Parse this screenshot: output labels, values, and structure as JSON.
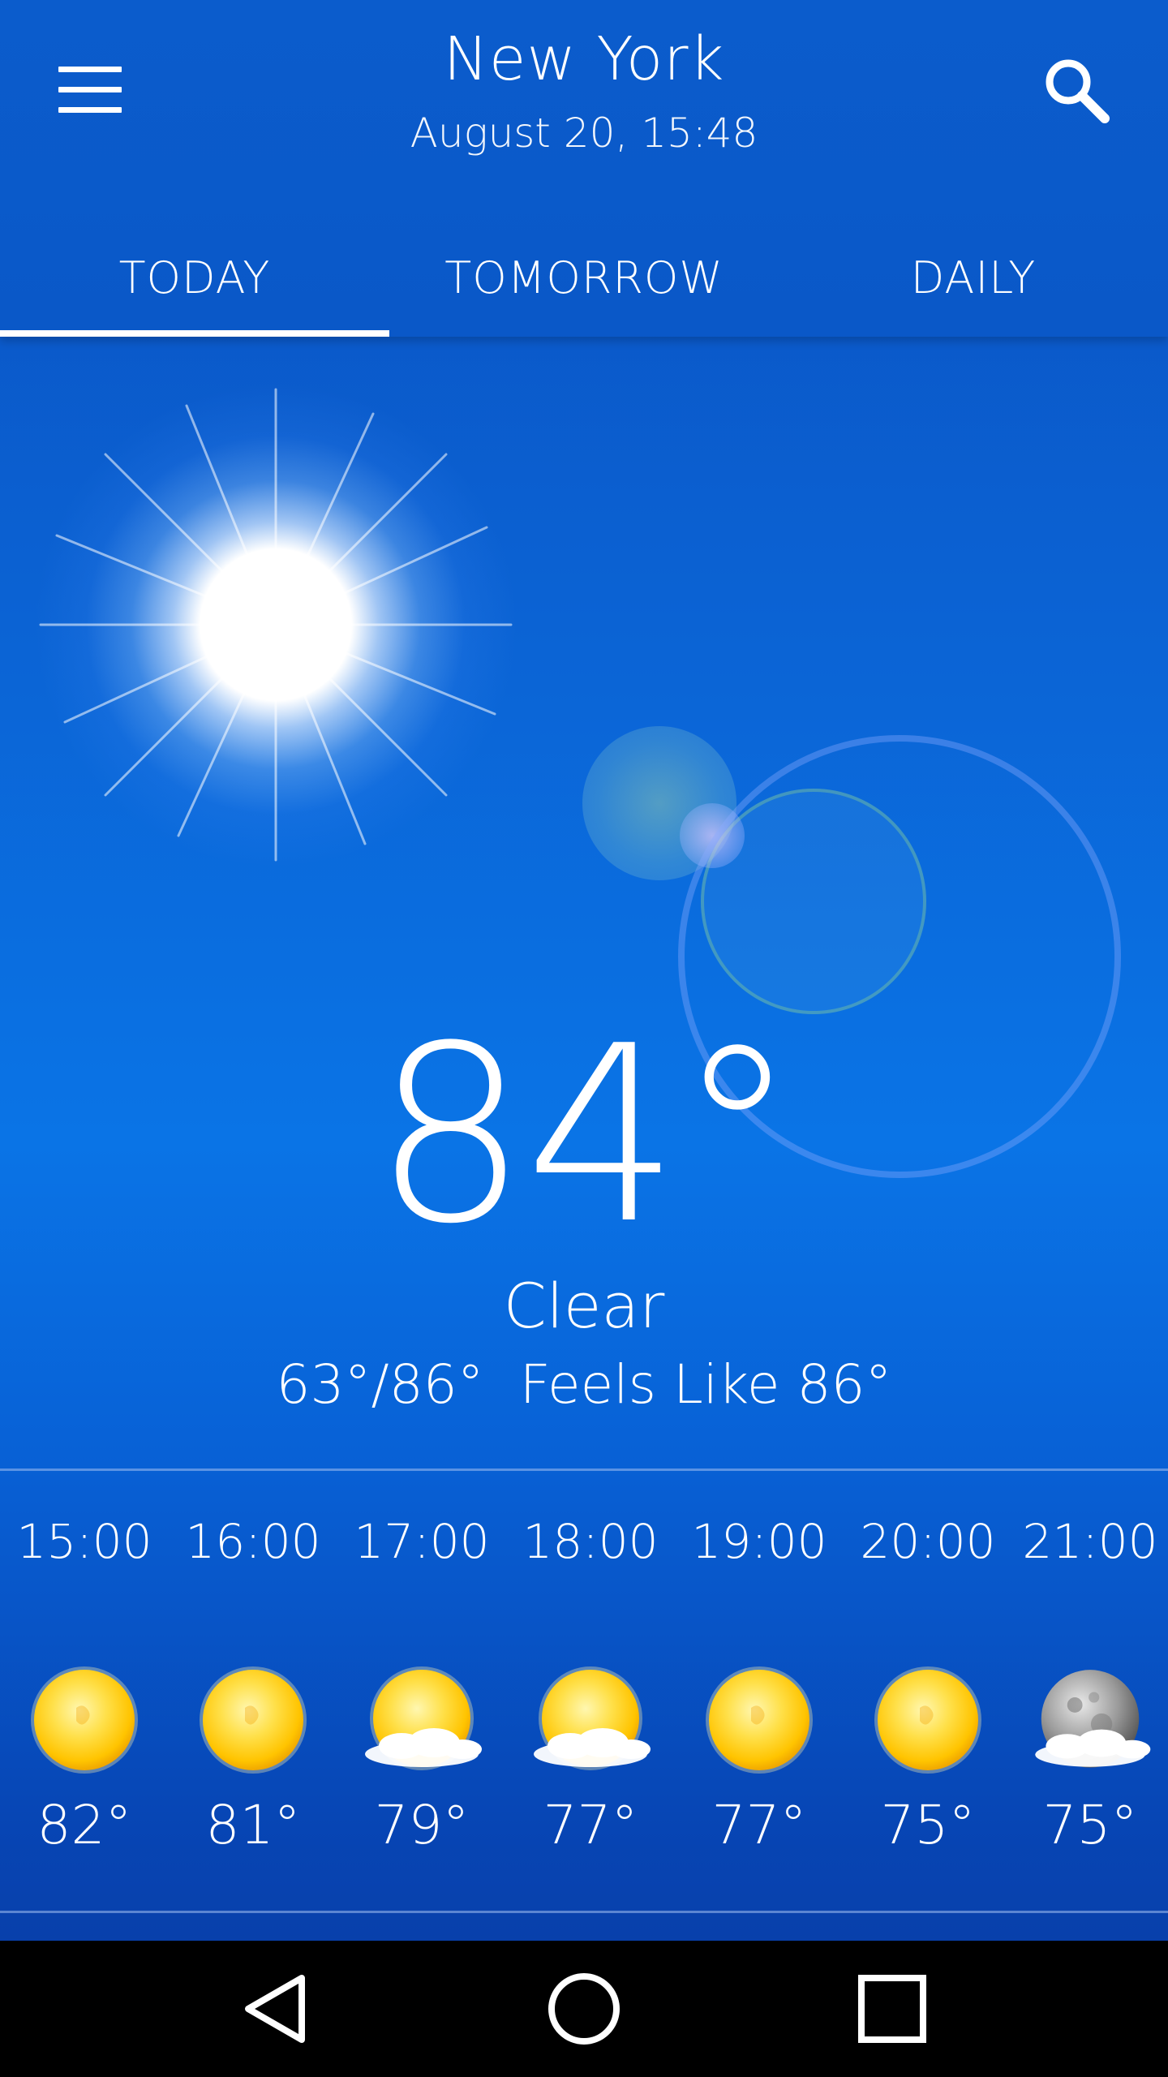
{
  "header": {
    "city": "New York",
    "datetime": "August 20, 15:48",
    "menu_icon": "menu-icon",
    "search_icon": "search-icon"
  },
  "tabs": [
    {
      "label": "TODAY",
      "active": true
    },
    {
      "label": "TOMORROW",
      "active": false
    },
    {
      "label": "DAILY",
      "active": false
    }
  ],
  "current": {
    "temperature": "84°",
    "condition": "Clear",
    "low_high": "63°/86°",
    "feels_like": "Feels Like 86°"
  },
  "hourly": [
    {
      "time": "15:00",
      "icon": "sun-icon",
      "temp": "82°"
    },
    {
      "time": "16:00",
      "icon": "sun-icon",
      "temp": "81°"
    },
    {
      "time": "17:00",
      "icon": "sun-cloud-icon",
      "temp": "79°"
    },
    {
      "time": "18:00",
      "icon": "sun-cloud-icon",
      "temp": "77°"
    },
    {
      "time": "19:00",
      "icon": "sun-icon",
      "temp": "77°"
    },
    {
      "time": "20:00",
      "icon": "sun-icon",
      "temp": "75°"
    },
    {
      "time": "21:00",
      "icon": "moon-cloud-icon",
      "temp": "75°"
    }
  ],
  "navbar": {
    "back_icon": "back-triangle-icon",
    "home_icon": "home-circle-icon",
    "recents_icon": "recents-square-icon"
  },
  "colors": {
    "header_bg": "#0b5ccc",
    "sky_top": "#0a4fbf",
    "sky_mid": "#0a74e6",
    "sky_bottom": "#0a3aa0",
    "sun_yellow": "#ffd21f",
    "navbar_bg": "#000000"
  }
}
